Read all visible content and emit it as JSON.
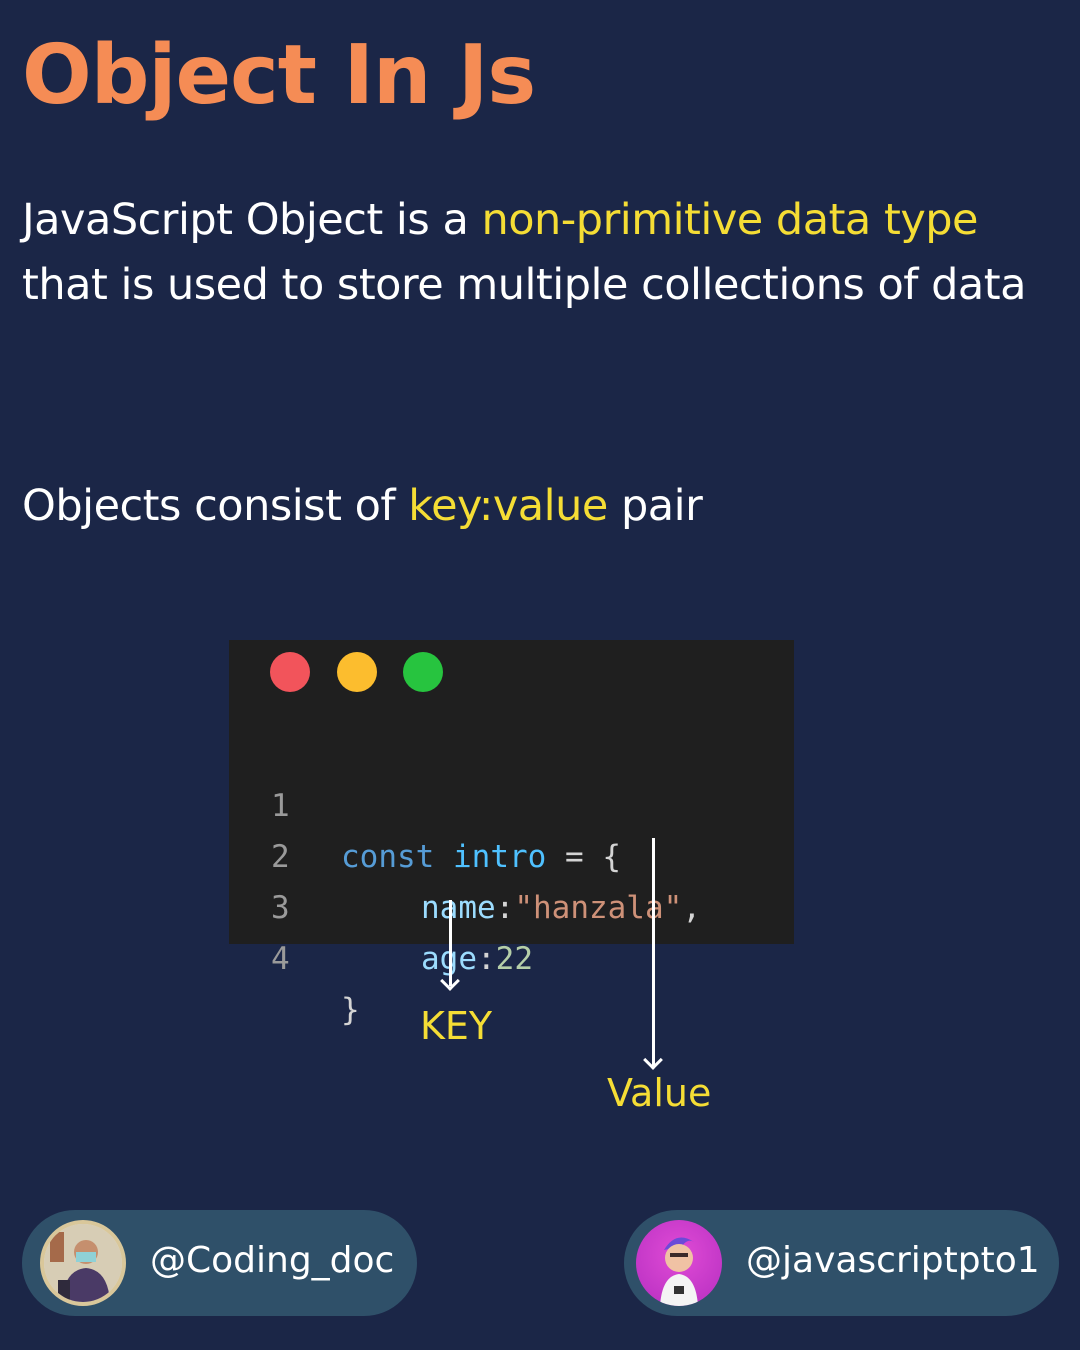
{
  "title": "Object In Js",
  "intro": {
    "part1": "JavaScript Object is a ",
    "highlight": "non-primitive data type",
    "part2": " that is used to store multiple collections of data"
  },
  "pair_line": {
    "part1": "Objects consist of ",
    "highlight": "key:value",
    "part2": " pair"
  },
  "code": {
    "line_numbers": [
      "1",
      "2",
      "3",
      "4"
    ],
    "line1": {
      "keyword": "const",
      "name": "intro",
      "op": " = {"
    },
    "line2": {
      "key": "name",
      "colon": ":",
      "value": "\"hanzala\"",
      "comma": ","
    },
    "line3": {
      "key": "age",
      "colon": ":",
      "value": "22"
    },
    "line4": {
      "close": "}"
    }
  },
  "annotations": {
    "key_label": "KEY",
    "value_label": "Value"
  },
  "footer": {
    "left_handle": "@Coding_doc",
    "right_handle": "@javascriptpto1"
  },
  "colors": {
    "background": "#1b2647",
    "title": "#f58c55",
    "highlight": "#f5dd35",
    "pill": "#2f5069"
  }
}
